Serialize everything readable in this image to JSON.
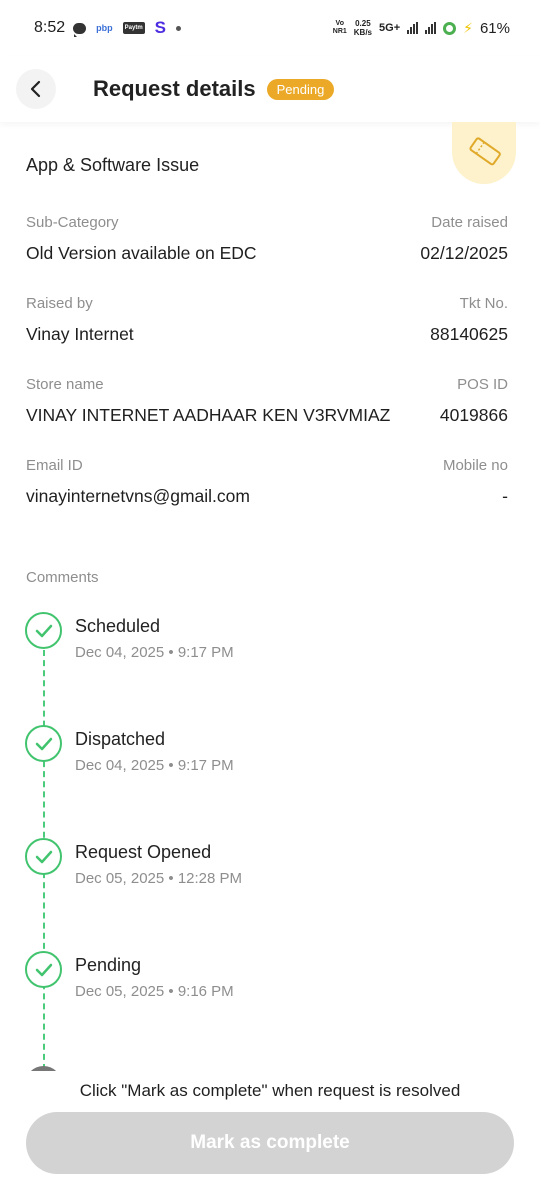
{
  "status_bar": {
    "time": "8:52",
    "pbp": "pbp",
    "paytm": "Paytm",
    "s_icon": "S",
    "vo": "Vo",
    "nr": "NR1",
    "speed": "0.25",
    "speed_unit": "KB/s",
    "network": "5G+",
    "battery": "61%"
  },
  "header": {
    "title": "Request details",
    "status_badge": "Pending"
  },
  "request": {
    "category": "App & Software Issue",
    "fields": {
      "sub_category_label": "Sub-Category",
      "sub_category_value": "Old Version available on EDC",
      "date_raised_label": "Date raised",
      "date_raised_value": "02/12/2025",
      "raised_by_label": "Raised by",
      "raised_by_value": "Vinay Internet",
      "ticket_label": "Tkt No.",
      "ticket_value": "88140625",
      "store_label": "Store name",
      "store_value": "VINAY INTERNET AADHAAR KEN V3RVMIAZ",
      "pos_label": "POS ID",
      "pos_value": "4019866",
      "email_label": "Email ID",
      "email_value": "vinayinternetvns@gmail.com",
      "mobile_label": "Mobile no",
      "mobile_value": "-"
    }
  },
  "comments": {
    "label": "Comments",
    "items": [
      {
        "title": "Scheduled",
        "date": "Dec 04, 2025 • 9:17 PM"
      },
      {
        "title": "Dispatched",
        "date": "Dec 04, 2025 • 9:17 PM"
      },
      {
        "title": "Request Opened",
        "date": "Dec 05, 2025 • 12:28 PM"
      },
      {
        "title": "Pending",
        "date": "Dec 05, 2025 • 9:16 PM"
      }
    ]
  },
  "footer": {
    "hint": "Click \"Mark as complete\" when request is resolved",
    "button_label": "Mark as complete"
  },
  "colors": {
    "badge": "#eba927",
    "check_green": "#42c46f",
    "button_disabled": "#d3d3d3"
  },
  "icons": [
    "back-arrow-icon",
    "ticket-icon",
    "check-icon"
  ]
}
